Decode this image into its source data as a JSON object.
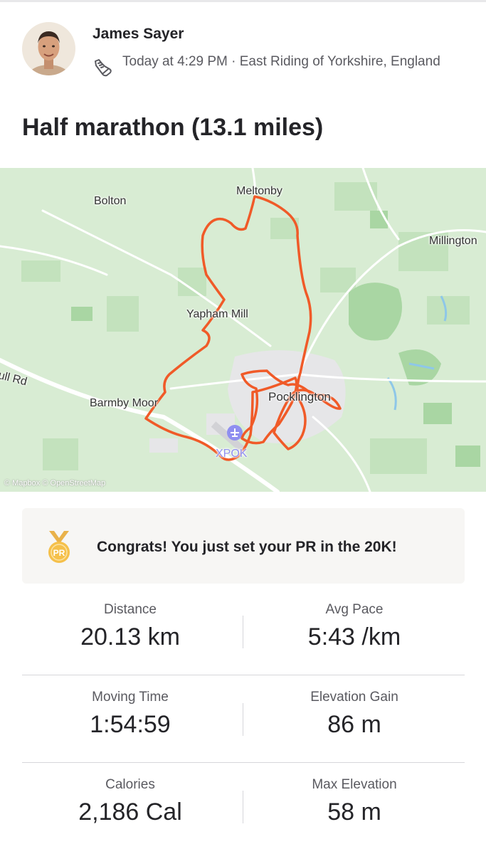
{
  "post": {
    "athlete_name": "James Sayer",
    "activity_icon": "running-shoe-icon",
    "meta": "Today at 4:29 PM · East Riding of Yorkshire, England",
    "title": "Half marathon (13.1 miles)"
  },
  "map": {
    "places": {
      "meltonby": "Meltonby",
      "bolton": "Bolton",
      "millington": "Millington",
      "yapham_mill": "Yapham Mill",
      "road": "ull Rd",
      "barmby_moor": "Barmby Moor",
      "pocklington": "Pocklington",
      "airfield": "XPOK"
    },
    "attribution": "© Mapbox © OpenStreetMap",
    "route_color": "#f05a28"
  },
  "achievement": {
    "icon": "pr-medal-icon",
    "badge": "PR",
    "text": "Congrats! You just set your PR in the 20K!"
  },
  "stats": [
    {
      "label": "Distance",
      "value": "20.13 km"
    },
    {
      "label": "Avg Pace",
      "value": "5:43 /km"
    },
    {
      "label": "Moving Time",
      "value": "1:54:59"
    },
    {
      "label": "Elevation Gain",
      "value": "86 m"
    },
    {
      "label": "Calories",
      "value": "2,186 Cal"
    },
    {
      "label": "Max Elevation",
      "value": "58 m"
    }
  ]
}
